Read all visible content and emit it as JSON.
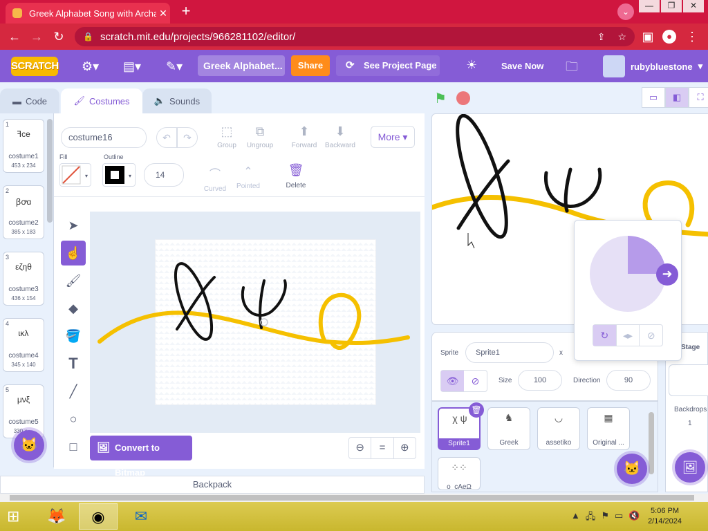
{
  "browser": {
    "tab_title": "Greek Alphabet Song with Archa",
    "url": "scratch.mit.edu/projects/966281102/editor/",
    "profile_initial": "∨"
  },
  "menu": {
    "logo": "SCRATCH",
    "project_title": "Greek Alphabet...",
    "share": "Share",
    "see_project": "See Project Page",
    "save_now": "Save Now",
    "username": "rubybluestone"
  },
  "tabs": {
    "code": "Code",
    "costumes": "Costumes",
    "sounds": "Sounds"
  },
  "costumes": [
    {
      "num": "1",
      "name": "costume1",
      "size": "453 x 234",
      "thumb": "ꟻce"
    },
    {
      "num": "2",
      "name": "costume2",
      "size": "385 x 183",
      "thumb": "ꞵꝍɑ"
    },
    {
      "num": "3",
      "name": "costume3",
      "size": "436 x 154",
      "thumb": "εζηθ"
    },
    {
      "num": "4",
      "name": "costume4",
      "size": "345 x 140",
      "thumb": "ɩκλ"
    },
    {
      "num": "5",
      "name": "costume5",
      "size": "330 x ...",
      "thumb": "μνξ"
    }
  ],
  "paint": {
    "costume_name": "costume16",
    "group": "Group",
    "ungroup": "Ungroup",
    "forward": "Forward",
    "backward": "Backward",
    "more": "More",
    "fill_label": "Fill",
    "outline_label": "Outline",
    "stroke_width": "14",
    "curved": "Curved",
    "pointed": "Pointed",
    "delete": "Delete",
    "convert": "Convert to Bitmap",
    "zoom_reset": "="
  },
  "backpack": "Backpack",
  "sprite_info": {
    "sprite_label": "Sprite",
    "sprite_name": "Sprite1",
    "x_label": "x",
    "size_label": "Size",
    "size": "100",
    "direction_label": "Direction",
    "direction": "90"
  },
  "sprites": [
    {
      "name": "Sprite1",
      "thumb": "χ ψ"
    },
    {
      "name": "Greek",
      "thumb": "♞"
    },
    {
      "name": "assetiko",
      "thumb": "◡"
    },
    {
      "name": "Original ...",
      "thumb": "▦"
    },
    {
      "name": "o_cAeΩ",
      "thumb": "⁘⁘"
    }
  ],
  "stage_panel": {
    "label": "Stage",
    "backdrops_label": "Backdrops",
    "backdrops_count": "1"
  },
  "taskbar": {
    "time": "5:06 PM",
    "date": "2/14/2024"
  },
  "colors": {
    "accent": "#855cd6",
    "tabbar": "#d0163f",
    "share": "#ff8c1a",
    "pen_gold": "#f5c000"
  }
}
